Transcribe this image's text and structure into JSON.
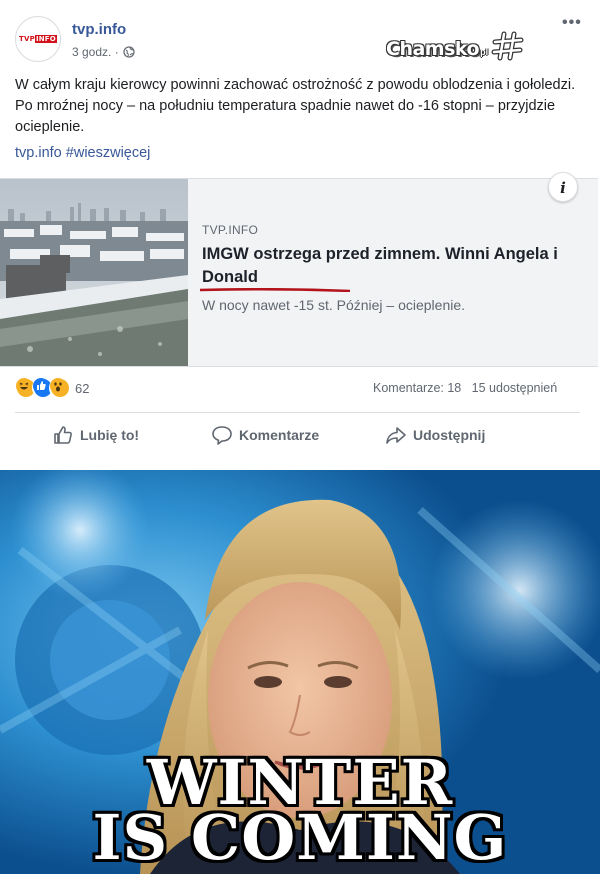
{
  "post": {
    "page_name": "tvp.info",
    "time": "3 godz. ·",
    "avatar_logo": {
      "tv": "TVP",
      "info": "INFO"
    },
    "more_label": "•••",
    "text": "W całym kraju kierowcy powinni zachować ostrożność z powodu oblodzenia i gołoledzi. Po mroźnej nocy – na południu temperatura spadnie nawet do -16 stopni – przyjdzie ocieplenie.",
    "link_text": "tvp.info",
    "hashtag": "#wieszwięcej"
  },
  "watermark": {
    "text": "Chamsko",
    "suffix": "pl"
  },
  "link_card": {
    "source": "TVP.INFO",
    "title": "IMGW ostrzega przed zimnem. Winni Angela i Donald",
    "description": "W nocy nawet -15 st. Później – ocieplenie.",
    "info_label": "i"
  },
  "engagement": {
    "reaction_count": "62",
    "comments": "Komentarze: 18",
    "shares": "15 udostępnień",
    "reactions": [
      "haha",
      "like",
      "wow"
    ]
  },
  "actions": {
    "like": "Lubię to!",
    "comment": "Komentarze",
    "share": "Udostępnij"
  },
  "meme": {
    "line1": "WINTER",
    "line2": "IS COMING"
  },
  "colors": {
    "link": "#385898",
    "brand_red": "#d4121b",
    "muted": "#606770",
    "underline_red": "#b3131b"
  }
}
